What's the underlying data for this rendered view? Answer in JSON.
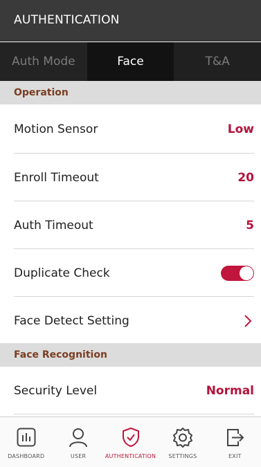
{
  "header": {
    "title": "AUTHENTICATION"
  },
  "tabs": [
    {
      "label": "Auth Mode",
      "active": false
    },
    {
      "label": "Face",
      "active": true
    },
    {
      "label": "T&A",
      "active": false
    }
  ],
  "sections": {
    "operation": {
      "title": "Operation",
      "rows": {
        "motion_sensor": {
          "label": "Motion Sensor",
          "value": "Low"
        },
        "enroll_timeout": {
          "label": "Enroll Timeout",
          "value": "20"
        },
        "auth_timeout": {
          "label": "Auth Timeout",
          "value": "5"
        },
        "duplicate_check": {
          "label": "Duplicate Check",
          "enabled": true
        },
        "face_detect_setting": {
          "label": "Face Detect Setting"
        }
      }
    },
    "face_recognition": {
      "title": "Face Recognition",
      "rows": {
        "security_level": {
          "label": "Security Level",
          "value": "Normal"
        }
      }
    }
  },
  "bottom_nav": [
    {
      "label": "DASHBOARD",
      "icon": "dashboard-icon",
      "active": false
    },
    {
      "label": "USER",
      "icon": "user-icon",
      "active": false
    },
    {
      "label": "AUTHENTICATION",
      "icon": "shield-check-icon",
      "active": true
    },
    {
      "label": "SETTINGS",
      "icon": "gear-icon",
      "active": false
    },
    {
      "label": "EXIT",
      "icon": "exit-icon",
      "active": false
    }
  ],
  "colors": {
    "accent": "#c0153d",
    "value_text": "#b5123a",
    "section_header_bg": "#dcdcdc",
    "section_header_text": "#7b3e22",
    "title_bar_bg": "#3a3a3a",
    "tab_bar_bg": "#262626"
  }
}
